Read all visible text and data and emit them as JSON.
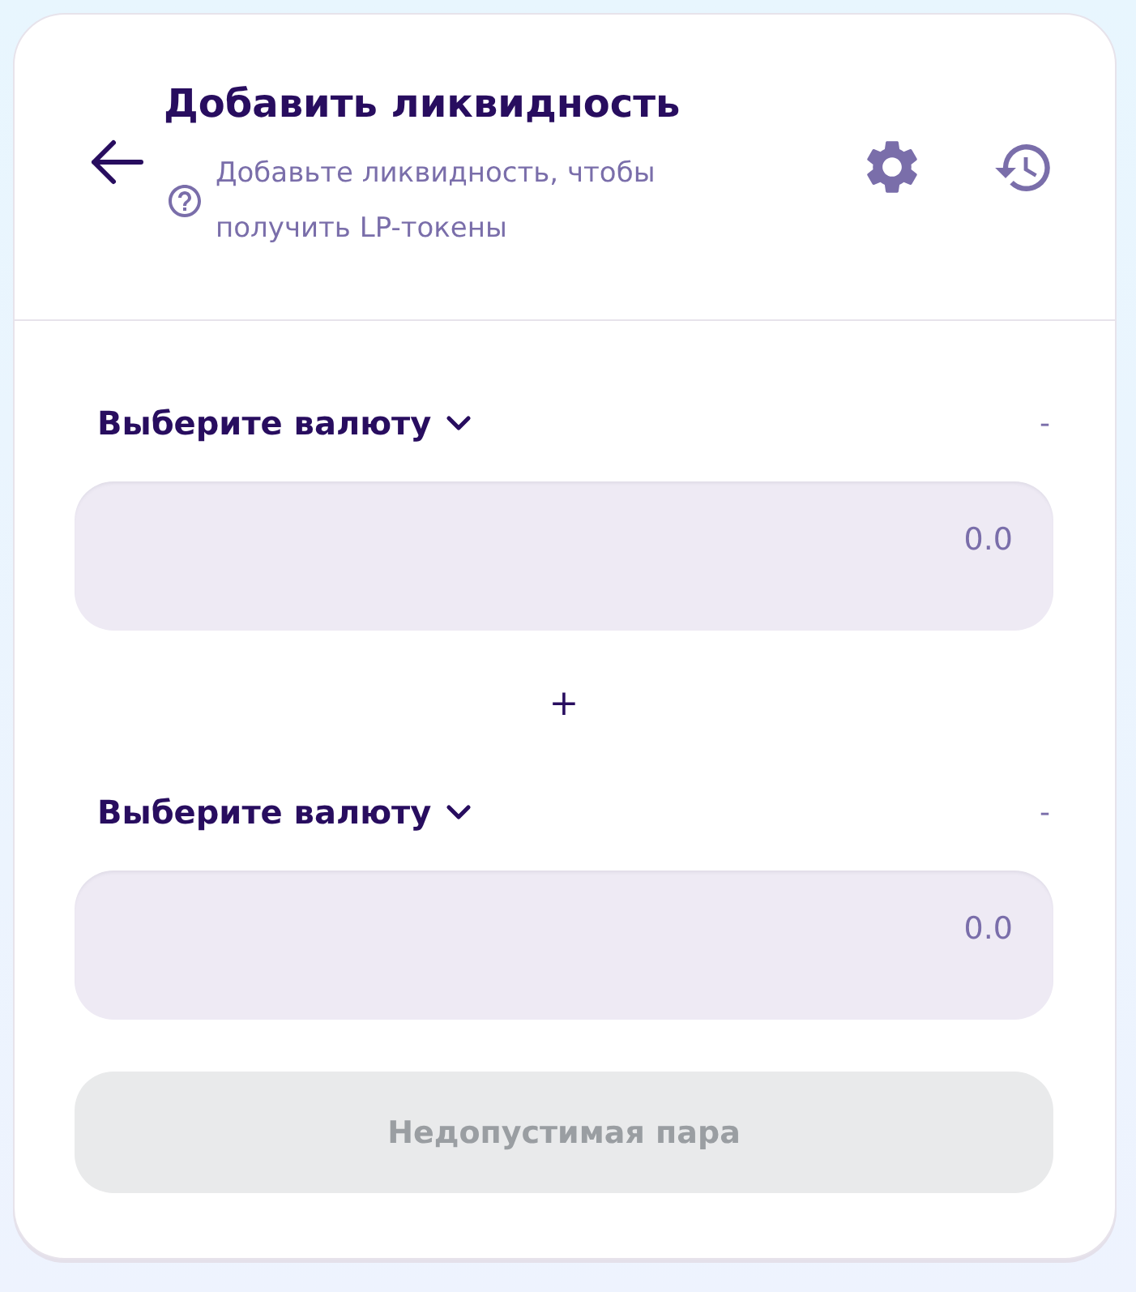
{
  "header": {
    "title": "Добавить ликвидность",
    "subtitle": "Добавьте ликвидность, чтобы получить LP-токены"
  },
  "currency_inputs": [
    {
      "label": "Выберите валюту",
      "balance": "-",
      "placeholder": "0.0"
    },
    {
      "label": "Выберите валюту",
      "balance": "-",
      "placeholder": "0.0"
    }
  ],
  "separator": "+",
  "submit_button": {
    "label": "Недопустимая пара",
    "disabled": true
  }
}
